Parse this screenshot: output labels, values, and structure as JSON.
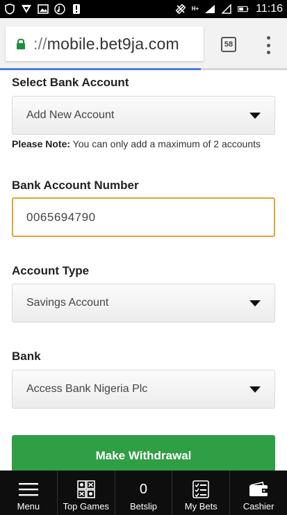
{
  "status_bar": {
    "time": "11:16",
    "network_label": "H+"
  },
  "browser": {
    "url_scheme": "://",
    "url_host": "mobile.bet9ja.com",
    "tab_count": "58",
    "load_progress": 0.7
  },
  "form": {
    "select_bank_account": {
      "label": "Select Bank Account",
      "value": "Add New Account"
    },
    "note": {
      "prefix": "Please Note:",
      "text": " You can only add a maximum of 2 accounts"
    },
    "bank_account_number": {
      "label": "Bank Account Number",
      "value": "0065694790"
    },
    "account_type": {
      "label": "Account Type",
      "value": "Savings Account"
    },
    "bank": {
      "label": "Bank",
      "value": "Access Bank Nigeria Plc"
    },
    "submit_label": "Make Withdrawal"
  },
  "bottom_nav": {
    "items": [
      {
        "label": "Menu",
        "icon": "hamburger-icon"
      },
      {
        "label": "Top Games",
        "icon": "games-grid-icon"
      },
      {
        "label": "Betslip",
        "count": "0"
      },
      {
        "label": "My Bets",
        "icon": "checklist-icon"
      },
      {
        "label": "Cashier",
        "icon": "wallet-icon"
      }
    ]
  },
  "colors": {
    "primary_green": "#2f9e44",
    "focus_border": "#e0a43a",
    "nav_background": "#0e0e0e",
    "lock_green": "#1e8e3e"
  }
}
